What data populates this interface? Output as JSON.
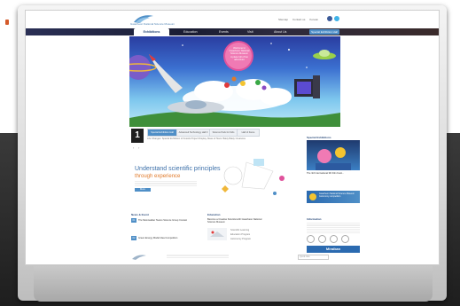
{
  "header": {
    "logo_text": "Gwacheon National Science Museum",
    "top_links": [
      "Sitemap",
      "Contact us",
      "Korean"
    ]
  },
  "nav": {
    "items": [
      "Exhibitions",
      "Education",
      "Events",
      "Visit",
      "About Us"
    ],
    "active": "Exhibitions",
    "right_button": "Special Exhibition Hall"
  },
  "hero": {
    "bubble_line1": "Welcome to",
    "bubble_line2": "Gwacheon National Science Museum",
    "bubble_line3": "A place full of fun adventure"
  },
  "news_tabs": {
    "number": "1",
    "tabs": [
      "Special Exhibition Hall",
      "Advanced Technology Hall II",
      "Science Park for Kids",
      "Hall of Fame"
    ],
    "caption": "Life Changes: Special Exhibition of Fossils Project Display, Mass of Stars: Bakiy Bakiy Creatures"
  },
  "headline": {
    "line1": "Understand scientific principles",
    "line2": "through experience",
    "more": "More"
  },
  "special_exhibitions": {
    "title": "Special Exhibitions",
    "caption": "The 3rd International 3D Film Festi...",
    "banner": "Gwacheon National Science Museum Astronomy competition"
  },
  "news_events": {
    "title": "News & Event",
    "items": [
      {
        "date": "01",
        "text": "The Moonwalker Teams Science Group Contest"
      },
      {
        "date": "02",
        "text": "Green Energy Model Idea Competition"
      }
    ]
  },
  "education": {
    "title": "Education",
    "heading": "Become a Creative Scientist with Gwacheon National Science Museum",
    "links": [
      "Scientific Learning",
      "Education Program",
      "Astronomy Program"
    ]
  },
  "information": {
    "title": "Information",
    "button": "Miraikan"
  },
  "footer": {
    "search_placeholder": "Quick links"
  },
  "colors": {
    "nav_bg": "#1a1d33",
    "accent_blue": "#4f8fc7",
    "accent_orange": "#e07a2a",
    "title_blue": "#3a6ea8"
  }
}
